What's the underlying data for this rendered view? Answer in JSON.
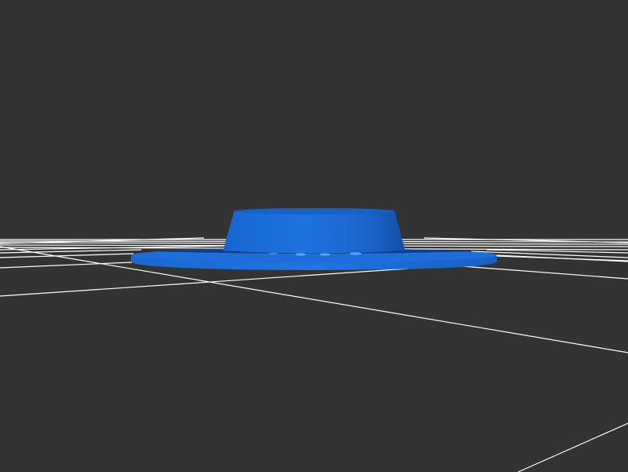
{
  "viewport": {
    "background_color": "#333333"
  },
  "grid": {
    "visible": true,
    "line_color": "#ffffff"
  },
  "model": {
    "shape": "flanged cylindrical cap on a thin disc base",
    "color": "#1e6fd9",
    "top_color": "#1a5fc4",
    "shadow_color": "#0d3f8f"
  }
}
